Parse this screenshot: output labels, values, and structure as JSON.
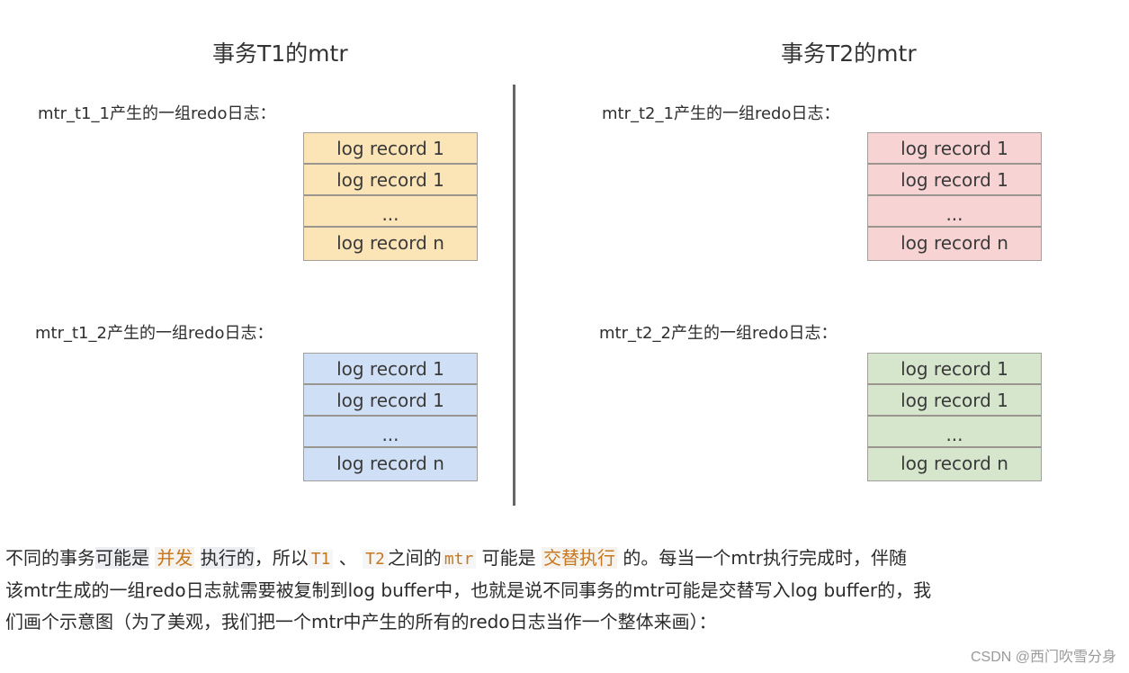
{
  "columns": [
    {
      "title": "事务T1的mtr",
      "groups": [
        {
          "label": "mtr_t1_1产生的一组redo日志：",
          "color": "#fbe4b6",
          "records": [
            "log record 1",
            "log record 1",
            "...",
            "log record n"
          ]
        },
        {
          "label": "mtr_t1_2产生的一组redo日志：",
          "color": "#cfe0f6",
          "records": [
            "log record 1",
            "log record 1",
            "...",
            "log record n"
          ]
        }
      ]
    },
    {
      "title": "事务T2的mtr",
      "groups": [
        {
          "label": "mtr_t2_1产生的一组redo日志：",
          "color": "#f7d3d3",
          "records": [
            "log record 1",
            "log record 1",
            "...",
            "log record n"
          ]
        },
        {
          "label": "mtr_t2_2产生的一组redo日志：",
          "color": "#d6e6cd",
          "records": [
            "log record 1",
            "log record 1",
            "...",
            "log record n"
          ]
        }
      ]
    }
  ],
  "paragraph": {
    "l1_a": "不同的事务",
    "l1_b": "可能是",
    "l1_c": "并发",
    "l1_d": "执行的",
    "l1_e": "，所以",
    "l1_t1": "T1",
    "l1_f": " 、 ",
    "l1_t2": "T2",
    "l1_g": "之间的",
    "l1_mtr": "mtr",
    "l1_h": " 可能是 ",
    "l1_i": "交替执行",
    "l1_j": " 的。每当一个mtr执行完成时，伴随",
    "l2": "该mtr生成的一组redo日志就需要被复制到log buffer中，也就是说不同事务的mtr可能是交替写入log buffer的，我",
    "l3": "们画个示意图（为了美观，我们把一个mtr中产生的所有的redo日志当作一个整体来画）："
  },
  "watermark": "CSDN @西门吹雪分身"
}
